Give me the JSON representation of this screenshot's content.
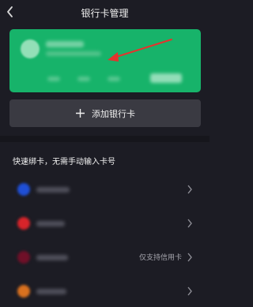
{
  "header": {
    "title": "银行卡管理",
    "back_icon": "chevron-left-icon"
  },
  "card": {
    "background": "#17b36a",
    "annotation": "red-arrow-icon"
  },
  "add_button": {
    "label": "添加银行卡",
    "icon": "plus-icon"
  },
  "quick_bind": {
    "title": "快速绑卡，无需手动输入卡号",
    "banks": [
      {
        "logo_color": "#1f4fd6",
        "hint": ""
      },
      {
        "logo_color": "#d8242a",
        "hint": ""
      },
      {
        "logo_color": "#6f1028",
        "hint": "仅支持信用卡"
      },
      {
        "logo_color": "#d9711f",
        "hint": ""
      }
    ]
  }
}
